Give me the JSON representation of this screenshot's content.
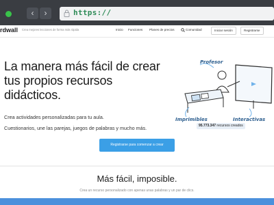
{
  "browser": {
    "url": "https://",
    "back_glyph": "‹",
    "forward_glyph": "›",
    "colors": {
      "chrome": "#3a3d42",
      "dot_green": "#39c34a",
      "url_text": "#2e8b57"
    }
  },
  "nav": {
    "logo": "rdwall",
    "tagline": "Crea mejores lecciones de forma más rápida",
    "links": [
      "Inicio",
      "Funciones",
      "Planes de precios",
      "Comunidad"
    ],
    "login": "Iniciar sesión",
    "signup": "Registrarse"
  },
  "hero": {
    "title_lines": [
      "La manera más fácil de crear",
      "tus propios recursos",
      "didácticos."
    ],
    "subtitle": "Crea actividades personalizadas para tu aula.",
    "subtitle2": "Cuestionarios, une las parejas, juegos de palabras y mucho más.",
    "cta": "Registrarse para comenzar a crear",
    "counter_value": "95.773.347",
    "counter_label": "recursos creados",
    "illustration_labels": {
      "teacher": "Profesor",
      "printables": "Imprimibles",
      "interactive": "Interactivas"
    }
  },
  "section2": {
    "title": "Más fácil, imposible.",
    "subtitle": "Crea un recurso personalizado con apenas unas palabras y un par de clics."
  },
  "colors": {
    "accent": "#3b9fe6",
    "background": "#4b90dc",
    "label_blue": "#2e5f8f"
  }
}
